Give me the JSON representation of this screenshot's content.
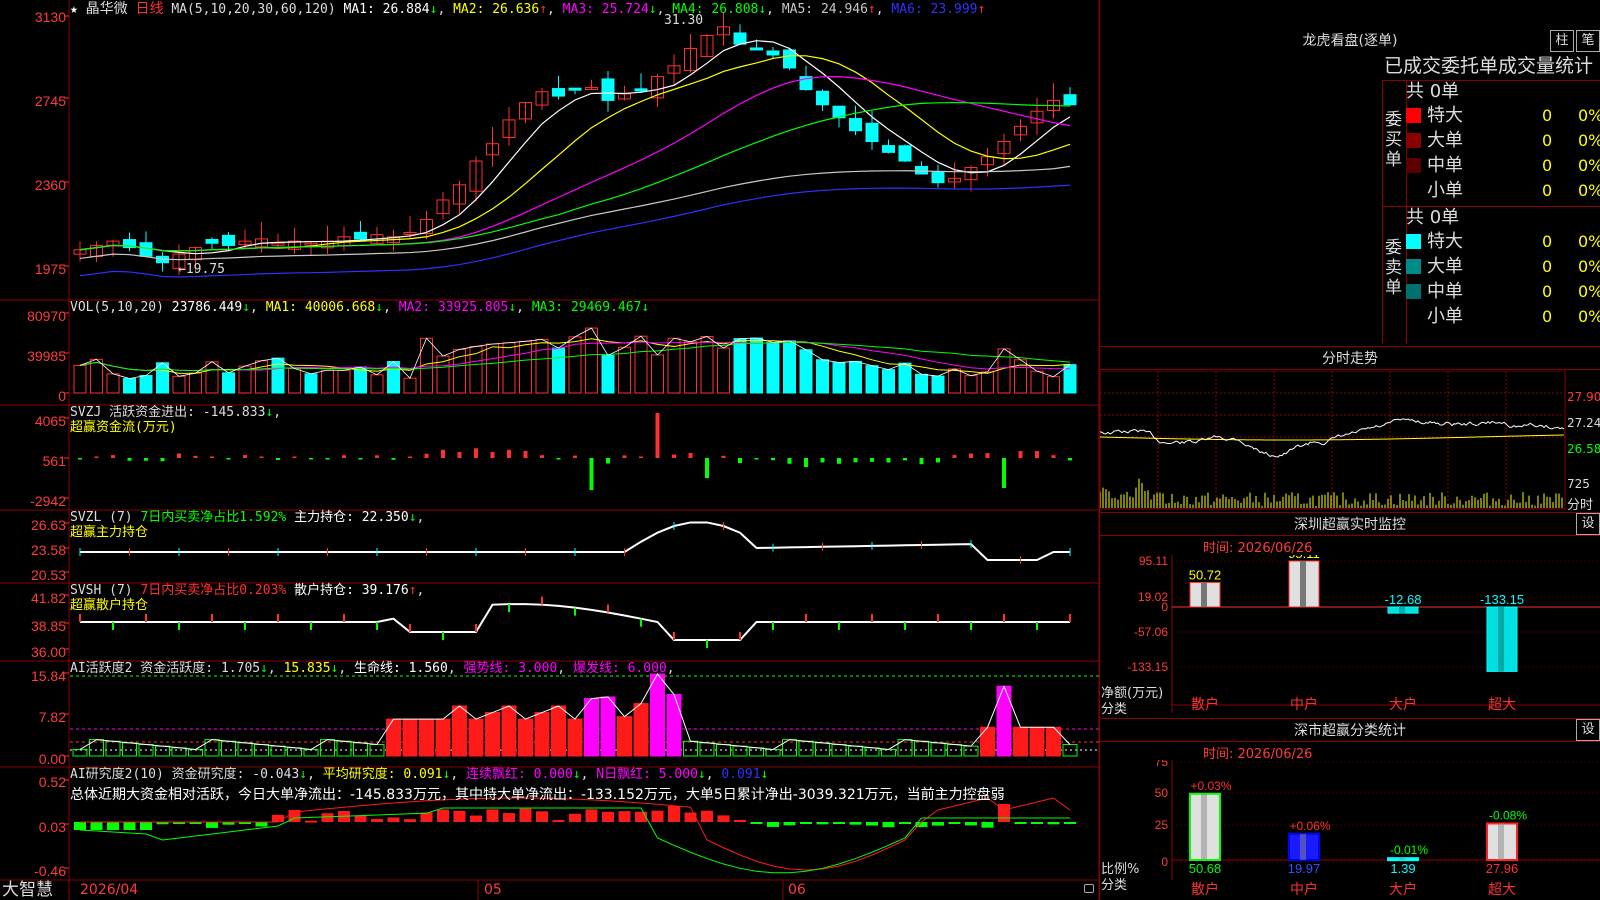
{
  "header": {
    "star": "★",
    "stock_name": "晶华微",
    "period": "日线",
    "ma_params": "MA(5,10,20,30,60,120)",
    "ma1": "MA1: 26.884",
    "ma2": "MA2: 26.636",
    "ma3": "MA3: 25.724",
    "ma4": "MA4: 26.808",
    "ma5": "MA5: 24.946",
    "ma6": "MA6: 23.999",
    "high_marker": "31.30",
    "low_marker": "19.75"
  },
  "price_axis": [
    "3130",
    "2745",
    "2360",
    "1975"
  ],
  "vol": {
    "label": "VOL(5,10,20)",
    "value": "23786.449",
    "ma1": "MA1: 40006.668",
    "ma2": "MA2: 33925.805",
    "ma3": "MA3: 29469.467",
    "axis": [
      "80970",
      "39985",
      "0"
    ]
  },
  "svzj": {
    "label": "SVZJ  活跃资金进出: -145.833",
    "sub": "超赢资金流(万元)",
    "axis": [
      "4065",
      "561",
      "-2942"
    ]
  },
  "svzl": {
    "label": "SVZL (7)",
    "pct": "7日内买卖净占比1.592%",
    "hold": "主力持仓: 22.350",
    "sub": "超赢主力持仓",
    "axis": [
      "26.63",
      "23.58",
      "20.53"
    ]
  },
  "svsh": {
    "label": "SVSH (7)",
    "pct": "7日内买卖净占比0.203%",
    "hold": "散户持仓: 39.176",
    "sub": "超赢散户持仓",
    "axis": [
      "41.82",
      "38.85",
      "36.00"
    ]
  },
  "ai1": {
    "label": "AI活跃度2 资金活跃度: 1.705",
    "v2": "15.835",
    "life": "生命线: 1.560",
    "strong": "强势线: 3.000",
    "burst": "爆发线: 6.000",
    "axis": [
      "15.84",
      "7.82",
      "0.00"
    ]
  },
  "ai2": {
    "label": "AI研究度2(10) 资金研究度: -0.043",
    "avg": "平均研究度: 0.091",
    "lian": "连续飘红: 0.000",
    "nred": "N日飘红: 5.000",
    "last": "0.091",
    "summary": "总体近期大资金相对活跃，今日大单净流出：-145.833万元，其中特大单净流出：-133.152万元，大单5日累计净出-3039.321万元，当前主力控盘弱",
    "axis": [
      "0.52",
      "0.03",
      "-0.46"
    ]
  },
  "bottom": {
    "logo": "大智慧",
    "date": "2026/04",
    "month5": "05",
    "month6": "06"
  },
  "lhb": {
    "title": "龙虎看盘(逐单)",
    "btn_zhu": "柱",
    "btn_bi": "笔",
    "table_title": "已成交委托单成交量统计",
    "buy_label": "委买单",
    "sell_label": "委卖单",
    "buy_total": "共 0单",
    "sell_total": "共 0单",
    "buy_rows": [
      {
        "name": "特大",
        "count": "0",
        "pct": "0%",
        "color": "#ff0000"
      },
      {
        "name": "大单",
        "count": "0",
        "pct": "0%",
        "color": "#8b0000"
      },
      {
        "name": "中单",
        "count": "0",
        "pct": "0%",
        "color": "#5a0000"
      },
      {
        "name": "小单",
        "count": "0",
        "pct": "0%",
        "color": ""
      }
    ],
    "sell_rows": [
      {
        "name": "特大",
        "count": "0",
        "pct": "0%",
        "color": "#00ffff"
      },
      {
        "name": "大单",
        "count": "0",
        "pct": "0%",
        "color": "#008b8b"
      },
      {
        "name": "中单",
        "count": "0",
        "pct": "0%",
        "color": "#006f6f"
      },
      {
        "name": "小单",
        "count": "0",
        "pct": "0%",
        "color": ""
      }
    ]
  },
  "intraday": {
    "title": "分时走势",
    "axis": [
      "27.90",
      "27.24",
      "26.58",
      "725"
    ],
    "footer": "分时"
  },
  "sz_monitor": {
    "title": "深圳超赢实时监控",
    "btn": "设",
    "time": "时间: 2026/06/26",
    "axis": [
      "95.11",
      "19.02",
      "0",
      "-57.06",
      "-133.15"
    ],
    "ylabel": "净额(万元)",
    "xlabel": "分类",
    "bars": [
      {
        "cat": "散户",
        "value": 50.72,
        "label": "50.72"
      },
      {
        "cat": "中户",
        "value": 95.11,
        "label": "95.11"
      },
      {
        "cat": "大户",
        "value": -12.68,
        "label": "-12.68"
      },
      {
        "cat": "超大",
        "value": -133.15,
        "label": "-133.15"
      }
    ]
  },
  "sz_class": {
    "title": "深市超赢分类统计",
    "btn": "设",
    "time": "时间: 2026/06/26",
    "axis": [
      "75",
      "50",
      "25",
      "0"
    ],
    "ylabel": "比例%",
    "xlabel": "分类",
    "bars": [
      {
        "cat": "散户",
        "value": 50.68,
        "label": "50.68",
        "delta": "+0.03%",
        "color": "#e0e0e0",
        "edge": "#00ff00"
      },
      {
        "cat": "中户",
        "value": 19.97,
        "label": "19.97",
        "delta": "+0.06%",
        "color": "#1a1aff",
        "edge": "#0000ff"
      },
      {
        "cat": "大户",
        "value": 1.39,
        "label": "1.39",
        "delta": "-0.01%",
        "color": "#00cfcf",
        "edge": "#00ffff"
      },
      {
        "cat": "超大",
        "value": 27.96,
        "label": "27.96",
        "delta": "-0.08%",
        "color": "#e0e0e0",
        "edge": "#ff2020"
      }
    ]
  }
}
